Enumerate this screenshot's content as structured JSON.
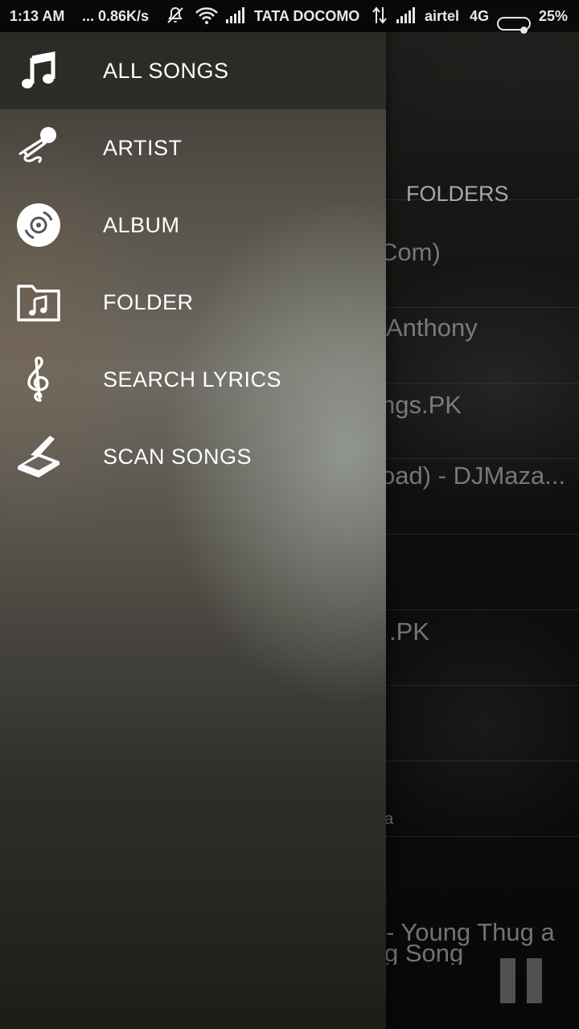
{
  "status_bar": {
    "time": "1:13 AM",
    "speed": "... 0.86K/s",
    "carrier1": "TATA DOCOMO",
    "carrier2": "airtel",
    "network_type": "4G",
    "battery_percent": "25%",
    "battery_level": 0.25
  },
  "background": {
    "tab_label": "FOLDERS",
    "song_rows": [
      "Com)",
      "Anthony",
      "ngs.PK",
      "oad) - DJMaza...",
      "",
      ".PK",
      "",
      "a",
      "- Young Thug a",
      "g Song"
    ]
  },
  "drawer": {
    "items": [
      {
        "label": "ALL SONGS",
        "icon": "music-note-icon",
        "selected": true
      },
      {
        "label": "ARTIST",
        "icon": "microphone-icon",
        "selected": false
      },
      {
        "label": "ALBUM",
        "icon": "disc-icon",
        "selected": false
      },
      {
        "label": "FOLDER",
        "icon": "music-folder-icon",
        "selected": false
      },
      {
        "label": "SEARCH LYRICS",
        "icon": "treble-clef-icon",
        "selected": false
      },
      {
        "label": "SCAN SONGS",
        "icon": "scanner-icon",
        "selected": false
      }
    ]
  },
  "colors": {
    "drawer_text": "#ffffff",
    "status_text": "#e8e8e8",
    "selected_bg": "#28261f"
  }
}
